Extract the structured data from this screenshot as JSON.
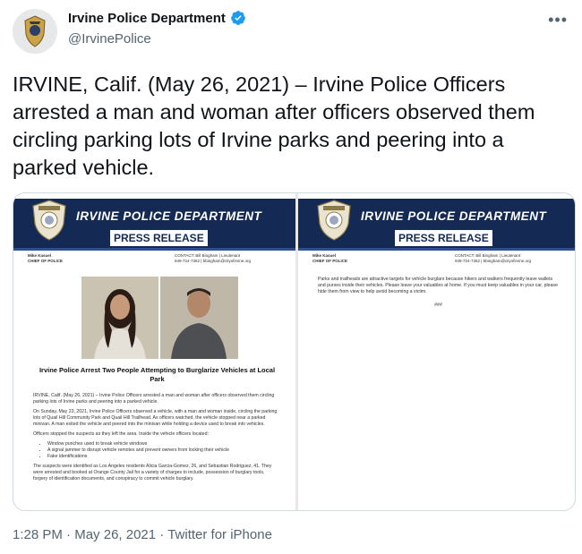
{
  "account": {
    "name": "Irvine Police Department",
    "handle": "@IrvinePolice"
  },
  "tweet": {
    "text": "IRVINE, Calif. (May 26, 2021) – Irvine Police Officers arrested a man and woman after officers observed them circling parking lots of Irvine parks and peering into a parked vehicle."
  },
  "more_icon": "more-dots-icon",
  "media": {
    "page1": {
      "banner_title": "IRVINE POLICE DEPARTMENT",
      "banner_subtitle": "PRESS RELEASE",
      "chief_name": "Mike Kasuel",
      "chief_title": "CHIEF OF POLICE",
      "contact_line1": "CONTACT: Bill Bingham | Lieutenant",
      "contact_line2": "949-724-7362 | bbingham@cityofirvine.org",
      "headline": "Irvine Police Arrest Two People Attempting to Burglarize Vehicles at Local Park",
      "p1": "IRVINE, Calif. (May 26, 2021) – Irvine Police Officers arrested a man and woman after officers observed them circling parking lots of Irvine parks and peering into a parked vehicle.",
      "p2": "On Sunday, May 23, 2021, Irvine Police Officers observed a vehicle, with a man and woman inside, circling the parking lots of Quail Hill Community Park and Quail Hill Trailhead. As officers watched, the vehicle stopped near a parked minivan. A man exited the vehicle and peered into the minivan while holding a device used to break into vehicles.",
      "p3": "Officers stopped the suspects as they left the area. Inside the vehicle officers located:",
      "bullets": [
        "Window punches used to break vehicle windows",
        "A signal jammer to disrupt vehicle remotes and prevent owners from locking their vehicle",
        "Fake identifications"
      ],
      "p4": "The suspects were identified as Los Angeles residents Alicia Garcia-Gomez, 26, and Sebastian Rodriguez, 41. They were arrested and booked at Orange County Jail for a variety of charges to include, possession of burglary tools, forgery of identification documents, and conspiracy to commit vehicle burglary."
    },
    "page2": {
      "banner_title": "IRVINE POLICE DEPARTMENT",
      "banner_subtitle": "PRESS RELEASE",
      "chief_name": "Mike Kasuel",
      "chief_title": "CHIEF OF POLICE",
      "contact_line1": "CONTACT: Bill Bingham | Lieutenant",
      "contact_line2": "949-724-7362 | bbingham@cityofirvine.org",
      "p1": "Parks and trailheads are attractive targets for vehicle burglars because hikers and walkers frequently leave wallets and purses inside their vehicles. Please leave your valuables at home. If you must keep valuables in your car, please hide them from view to help avoid becoming a victim.",
      "end_mark": "###"
    }
  },
  "footer": {
    "time": "1:28 PM",
    "separator": "·",
    "date": "May 26, 2021",
    "source": "Twitter for iPhone"
  },
  "colors": {
    "verified": "#1d9bf0",
    "banner": "#142a55",
    "secondary_text": "#536471"
  }
}
